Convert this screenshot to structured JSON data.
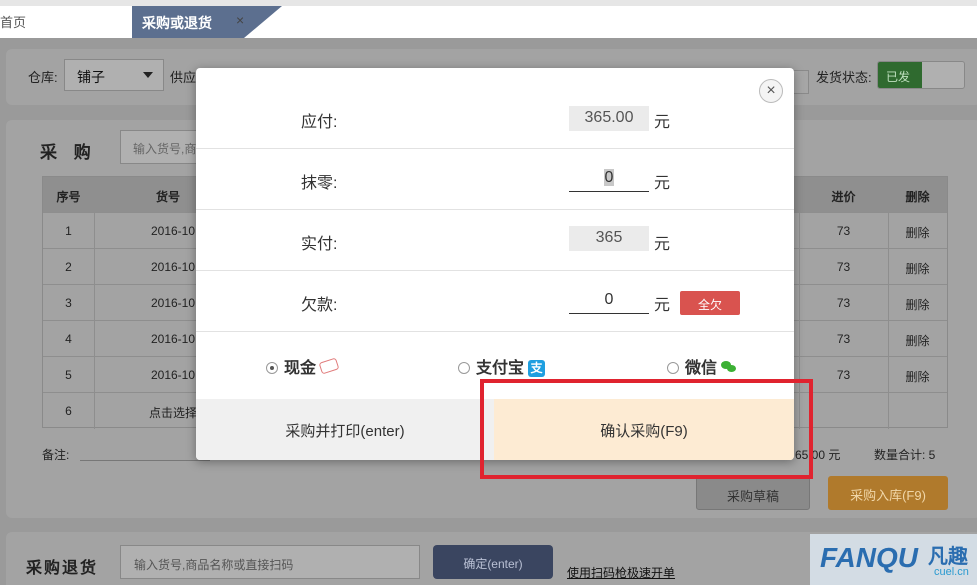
{
  "tabs": {
    "home": "首页",
    "active": "采购或退货",
    "close": "×"
  },
  "filter": {
    "warehouse_label": "仓库:",
    "warehouse_value": "铺子",
    "supplier_label": "供应",
    "ship_status_label": "发货状态:",
    "ship_status_value": "已发"
  },
  "purchase": {
    "title": "采 购",
    "search_placeholder": "输入货号,商品",
    "columns": {
      "seq": "序号",
      "sku": "货号",
      "price": "进价",
      "delete": "删除"
    },
    "rows": [
      {
        "seq": "1",
        "sku": "2016-10",
        "price": "73",
        "delete": "删除"
      },
      {
        "seq": "2",
        "sku": "2016-10",
        "price": "73",
        "delete": "删除"
      },
      {
        "seq": "3",
        "sku": "2016-10",
        "price": "73",
        "delete": "删除"
      },
      {
        "seq": "4",
        "sku": "2016-10",
        "price": "73",
        "delete": "删除"
      },
      {
        "seq": "5",
        "sku": "2016-10",
        "price": "73",
        "delete": "删除"
      },
      {
        "seq": "6",
        "sku": "点击选择",
        "price": "",
        "delete": ""
      }
    ],
    "remark_label": "备注:",
    "total_amount": "65.00  元",
    "total_qty": "数量合计: 5",
    "draft_button": "采购草稿",
    "stockin_button": "采购入库(F9)"
  },
  "return": {
    "title": "采购退货",
    "search_placeholder": "输入货号,商品名称或直接扫码",
    "confirm_button": "确定(enter)",
    "scan_link": "使用扫码枪极速开单"
  },
  "watermark": {
    "en": "FANQU",
    "cn": "凡趣",
    "url": "cuel.cn"
  },
  "modal": {
    "close": "×",
    "payable_label": "应付:",
    "payable_value": "365.00",
    "rounding_label": "抹零:",
    "rounding_value": "0",
    "actual_label": "实付:",
    "actual_value": "365",
    "owed_label": "欠款:",
    "owed_value": "0",
    "unit": "元",
    "all_owe_button": "全欠",
    "payment": {
      "cash": "现金",
      "alipay": "支付宝",
      "alipay_icon_char": "支",
      "wechat": "微信",
      "selected": "cash"
    },
    "print_button": "采购并打印(enter)",
    "confirm_button": "确认采购(F9)"
  },
  "colors": {
    "accent_tab": "#5c6f8f",
    "highlight": "#e0232f",
    "danger": "#d9534f",
    "confirm_bg": "#fdebd3",
    "alipay": "#1e9fe0",
    "wechat": "#3cb034"
  }
}
